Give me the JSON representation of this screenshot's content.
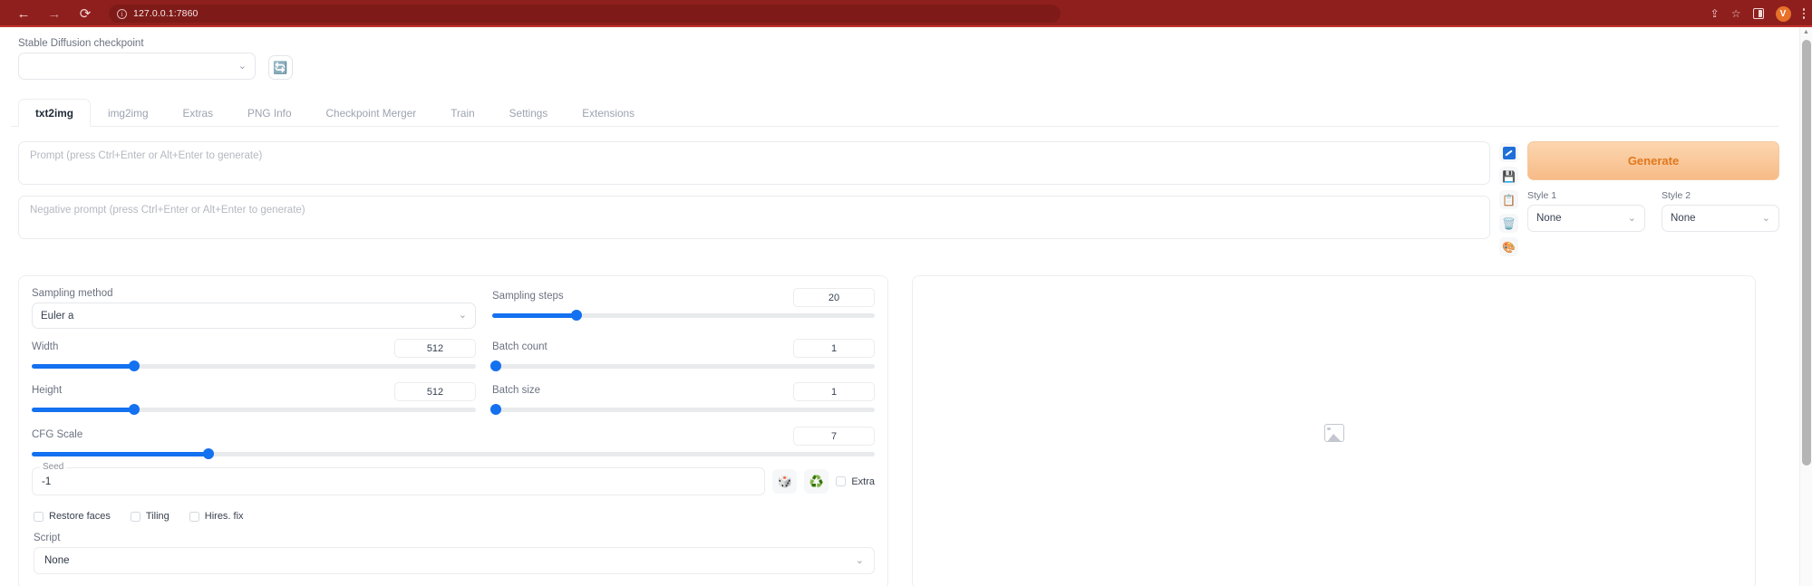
{
  "browser": {
    "back_icon": "←",
    "forward_icon": "→",
    "reload_icon": "⟳",
    "info_icon": "i",
    "url": "127.0.0.1:7860",
    "share_icon": "⇪",
    "bookmark_icon": "☆",
    "sidebar_icon": "sidebar",
    "profile_initial": "V",
    "menu_icon": "⋮",
    "bar_color": "#8f1f1d"
  },
  "checkpoint": {
    "label": "Stable Diffusion checkpoint",
    "value": "",
    "chevron": "⌄",
    "refresh_icon": "🔄"
  },
  "tabs": [
    {
      "label": "txt2img",
      "active": true
    },
    {
      "label": "img2img",
      "active": false
    },
    {
      "label": "Extras",
      "active": false
    },
    {
      "label": "PNG Info",
      "active": false
    },
    {
      "label": "Checkpoint Merger",
      "active": false
    },
    {
      "label": "Train",
      "active": false
    },
    {
      "label": "Settings",
      "active": false
    },
    {
      "label": "Extensions",
      "active": false
    }
  ],
  "prompt": {
    "placeholder": "Prompt (press Ctrl+Enter or Alt+Enter to generate)",
    "value": ""
  },
  "negative_prompt": {
    "placeholder": "Negative prompt (press Ctrl+Enter or Alt+Enter to generate)",
    "value": ""
  },
  "prompt_tools": [
    {
      "name": "paintbrush-icon",
      "glyph": ""
    },
    {
      "name": "save-icon",
      "glyph": "💾"
    },
    {
      "name": "clipboard-icon",
      "glyph": "📋"
    },
    {
      "name": "trash-icon",
      "glyph": "🗑️"
    },
    {
      "name": "palette-icon",
      "glyph": "🎨"
    }
  ],
  "generate": {
    "label": "Generate",
    "accent": "#e1781c"
  },
  "styles": {
    "style1_label": "Style 1",
    "style1_value": "None",
    "style2_label": "Style 2",
    "style2_value": "None"
  },
  "settings": {
    "sampling_method": {
      "label": "Sampling method",
      "value": "Euler a"
    },
    "sampling_steps": {
      "label": "Sampling steps",
      "value": "20",
      "percent": 22
    },
    "width": {
      "label": "Width",
      "value": "512",
      "percent": 23
    },
    "height": {
      "label": "Height",
      "value": "512",
      "percent": 23
    },
    "batch_count": {
      "label": "Batch count",
      "value": "1",
      "percent": 1
    },
    "batch_size": {
      "label": "Batch size",
      "value": "1",
      "percent": 1
    },
    "cfg_scale": {
      "label": "CFG Scale",
      "value": "7",
      "percent": 21
    },
    "seed": {
      "label": "Seed",
      "value": "-1"
    },
    "seed_dice_icon": "🎲",
    "seed_recycle_icon": "♻️",
    "extra_checkbox": {
      "label": "Extra",
      "checked": false
    },
    "toggles": [
      {
        "label": "Restore faces",
        "checked": false
      },
      {
        "label": "Tiling",
        "checked": false
      },
      {
        "label": "Hires. fix",
        "checked": false
      }
    ],
    "script": {
      "label": "Script",
      "value": "None"
    }
  },
  "output": {
    "placeholder_icon": "image-placeholder"
  },
  "slider_color": "#1471f0"
}
